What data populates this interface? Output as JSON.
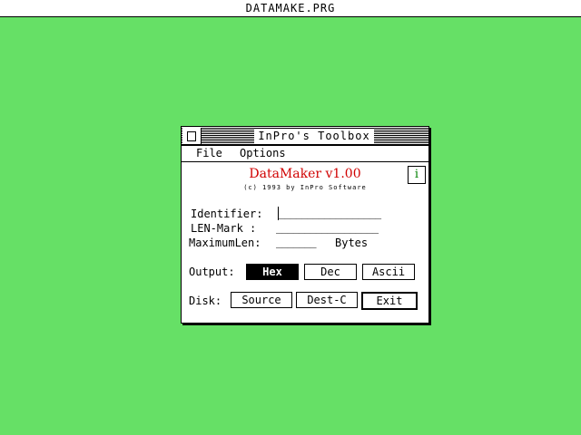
{
  "desktop": {
    "title": "DATAMAKE.PRG",
    "background_color": "#66e066"
  },
  "window": {
    "title": "InPro's Toolbox",
    "menu": [
      "File",
      "Options"
    ]
  },
  "app": {
    "title": "DataMaker  v1.00",
    "copyright": "(c) 1993 by InPro Software",
    "info_icon": "i",
    "title_color": "#d00000"
  },
  "form": {
    "identifier_label": "Identifier:",
    "identifier_value": "__________________",
    "lenmark_label": "LEN-Mark  :",
    "lenmark_value": "__________________",
    "maxlen_label": "MaximumLen:",
    "maxlen_value": "_______",
    "maxlen_unit": "Bytes"
  },
  "output": {
    "label": "Output:",
    "options": [
      "Hex",
      "Dec",
      "Ascii"
    ],
    "selected": "Hex"
  },
  "disk": {
    "label": "Disk:",
    "source": "Source",
    "dest": "Dest-C",
    "exit": "Exit"
  }
}
